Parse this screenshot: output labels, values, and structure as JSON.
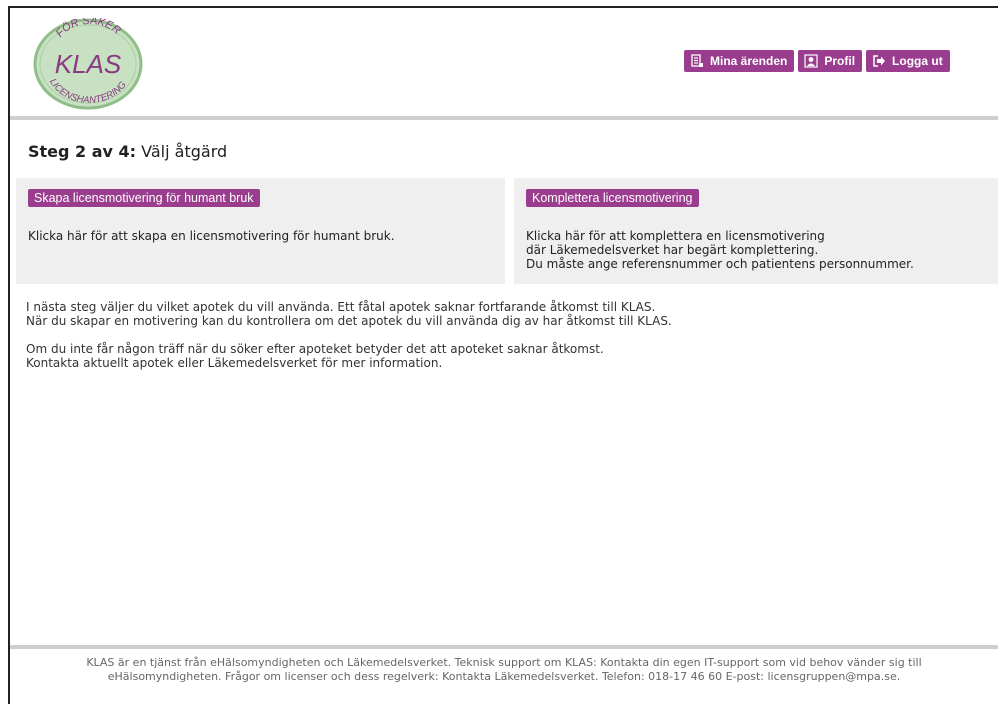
{
  "logo": {
    "line1": "FÖR SÄKER",
    "line2": "KLAS",
    "line3": "LICENSHANTERING",
    "colors": {
      "ring": "#8fbe89",
      "fill": "#c8e1c2",
      "text": "#8a3a82"
    }
  },
  "nav": {
    "my_cases": "Mina ärenden",
    "profile": "Profil",
    "logout": "Logga ut"
  },
  "step": {
    "prefix": "Steg 2 av 4:",
    "title": "Välj åtgärd"
  },
  "cards": {
    "create": {
      "label": "Skapa licensmotivering för humant bruk",
      "text": "Klicka här för att skapa en licensmotivering för humant bruk."
    },
    "complete": {
      "label": "Komplettera licensmotivering",
      "line1": "Klicka här för att komplettera en licensmotivering",
      "line2": "där Läkemedelsverket har begärt komplettering.",
      "line3": "Du måste ange referensnummer och patientens personnummer."
    }
  },
  "info": {
    "p1_line1": "I nästa steg väljer du vilket apotek du vill använda. Ett fåtal apotek saknar fortfarande åtkomst till KLAS.",
    "p1_line2": "När du skapar en motivering kan du kontrollera om det apotek du vill använda dig av har åtkomst till KLAS.",
    "p2_line1": "Om du inte får någon träff när du söker efter apoteket betyder det att apoteket saknar åtkomst.",
    "p2_line2": "Kontakta aktuellt apotek eller Läkemedelsverket för mer information."
  },
  "footer": {
    "line1": "KLAS är en tjänst från eHälsomyndigheten och Läkemedelsverket. Teknisk support om KLAS: Kontakta din egen IT-support som vid behov vänder sig till",
    "line2": "eHälsomyndigheten. Frågor om licenser och dess regelverk: Kontakta Läkemedelsverket. Telefon: 018-17 46 60 E-post: licensgruppen@mpa.se."
  },
  "colors": {
    "accent": "#9a3d8e",
    "card_bg": "#efefef",
    "separator": "#cfcfcf"
  }
}
